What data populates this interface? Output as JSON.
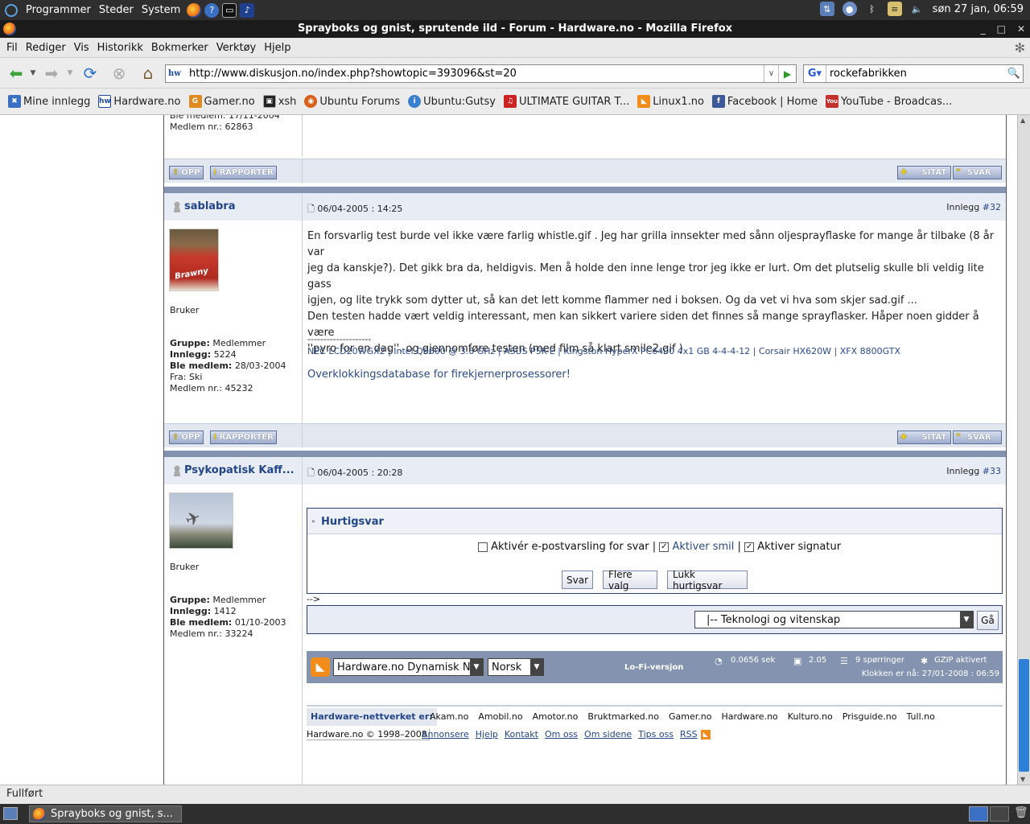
{
  "panel": {
    "menus": [
      "Programmer",
      "Steder",
      "System"
    ],
    "clock": "søn 27 jan, 06:59"
  },
  "window": {
    "title": "Sprayboks og gnist, sprutende ild - Forum - Hardware.no - Mozilla Firefox"
  },
  "menubar": [
    "Fil",
    "Rediger",
    "Vis",
    "Historikk",
    "Bokmerker",
    "Verktøy",
    "Hjelp"
  ],
  "nav": {
    "url": "http://www.diskusjon.no/index.php?showtopic=393096&st=20",
    "search_query": "rockefabrikken"
  },
  "bookmarks": [
    "Mine innlegg",
    "Hardware.no",
    "Gamer.no",
    "xsh",
    "Ubuntu Forums",
    "Ubuntu:Gutsy",
    "ULTIMATE GUITAR T...",
    "Linux1.no",
    "Facebook | Home",
    "YouTube - Broadcas..."
  ],
  "prev_post": {
    "joined_partial": "Ble medlem: 17/11-2004",
    "member_no": "Medlem nr.: 62863"
  },
  "buttons": {
    "up": "OPP",
    "report": "RAPPORTER",
    "quote": "SITAT",
    "reply": "SVAR"
  },
  "post32": {
    "username": "sablabra",
    "date": "06/04-2005 : 14:25",
    "post_label": "Innlegg",
    "post_number": "#32",
    "rank": "Bruker",
    "group_label": "Gruppe:",
    "group": "Medlemmer",
    "posts_label": "Innlegg:",
    "posts": "5224",
    "joined_label": "Ble medlem:",
    "joined": "28/03-2004",
    "from": "Fra: Ski",
    "member_no": "Medlem nr.: 45232",
    "avatar_text": "Brawny",
    "text_lines": [
      "En forsvarlig test burde vel ikke være farlig whistle.gif . Jeg har grilla innsekter med sånn oljesprayflaske for mange år tilbake (8 år var",
      "jeg da kanskje?). Det gikk bra da, heldigvis. Men å holde den inne lenge tror jeg ikke er lurt. Om det plutselig skulle bli veldig lite gass",
      "igjen, og lite trykk som dytter ut, så kan det lett komme flammer ned i boksen. Og da vet vi hva som skjer sad.gif ...",
      "Den testen hadde vært veldig interessant, men kan sikkert variere siden det finnes så mange sprayflasker. Håper noen gidder å være",
      "''pyro for en dag'', og gjennomføre testen (med film så klart smile2.gif )"
    ],
    "sig_divider": "--------------------",
    "sig_specs": "NEC LCD20WGX2 | Intel Q6600 @ 3.6 GHz | ASUS P5K-E | Kingston HyperX PC6400 4x1 GB 4-4-4-12 | Corsair HX620W | XFX 8800GTX",
    "sig_link": "Overklokkingsdatabase for firekjernerprosessorer!"
  },
  "post33": {
    "username": "Psykopatisk Kaff...",
    "date": "06/04-2005 : 20:28",
    "post_label": "Innlegg",
    "post_number": "#33",
    "rank": "Bruker",
    "group_label": "Gruppe:",
    "group": "Medlemmer",
    "posts_label": "Innlegg:",
    "posts": "1412",
    "joined_label": "Ble medlem:",
    "joined": "01/10-2003",
    "member_no": "Medlem nr.: 33224"
  },
  "quick_reply": {
    "title": "Hurtigsvar",
    "opt_email": "Aktivér e-postvarsling for svar",
    "opt_smilies": "Aktiver smil",
    "opt_signature": "Aktiver signatur",
    "sep": "|",
    "btn_reply": "Svar",
    "btn_more": "Flere valg",
    "btn_close": "Lukk hurtigsvar",
    "stray": "-->"
  },
  "jump": {
    "selected": "|-- Teknologi og vitenskap",
    "go": "Gå"
  },
  "footer": {
    "skin": "Hardware.no Dynamisk N",
    "lang": "Norsk",
    "lofi": "Lo-Fi-versjon",
    "time": "0.0656 sek",
    "load": "2.05",
    "queries": "9 spørringer",
    "gzip": "GZIP aktivert",
    "clock": "Klokken er nå: 27/01-2008 : 06:59"
  },
  "network": {
    "label": "Hardware-nettverket er:",
    "sites": [
      "Akam.no",
      "Amobil.no",
      "Amotor.no",
      "Bruktmarked.no",
      "Gamer.no",
      "Hardware.no",
      "Kulturo.no",
      "Prisguide.no",
      "Tull.no"
    ],
    "copyright": "Hardware.no © 1998–2008",
    "links": [
      "Annonsere",
      "Hjelp",
      "Kontakt",
      "Om oss",
      "Om sidene",
      "Tips oss",
      "RSS"
    ]
  },
  "status": "Fullført",
  "taskbar": {
    "item": "Sprayboks og gnist, s..."
  },
  "colors": {
    "forum_blue": "#22458a",
    "bar_blue": "#8494b0",
    "row_bg": "#e3e8f0"
  }
}
